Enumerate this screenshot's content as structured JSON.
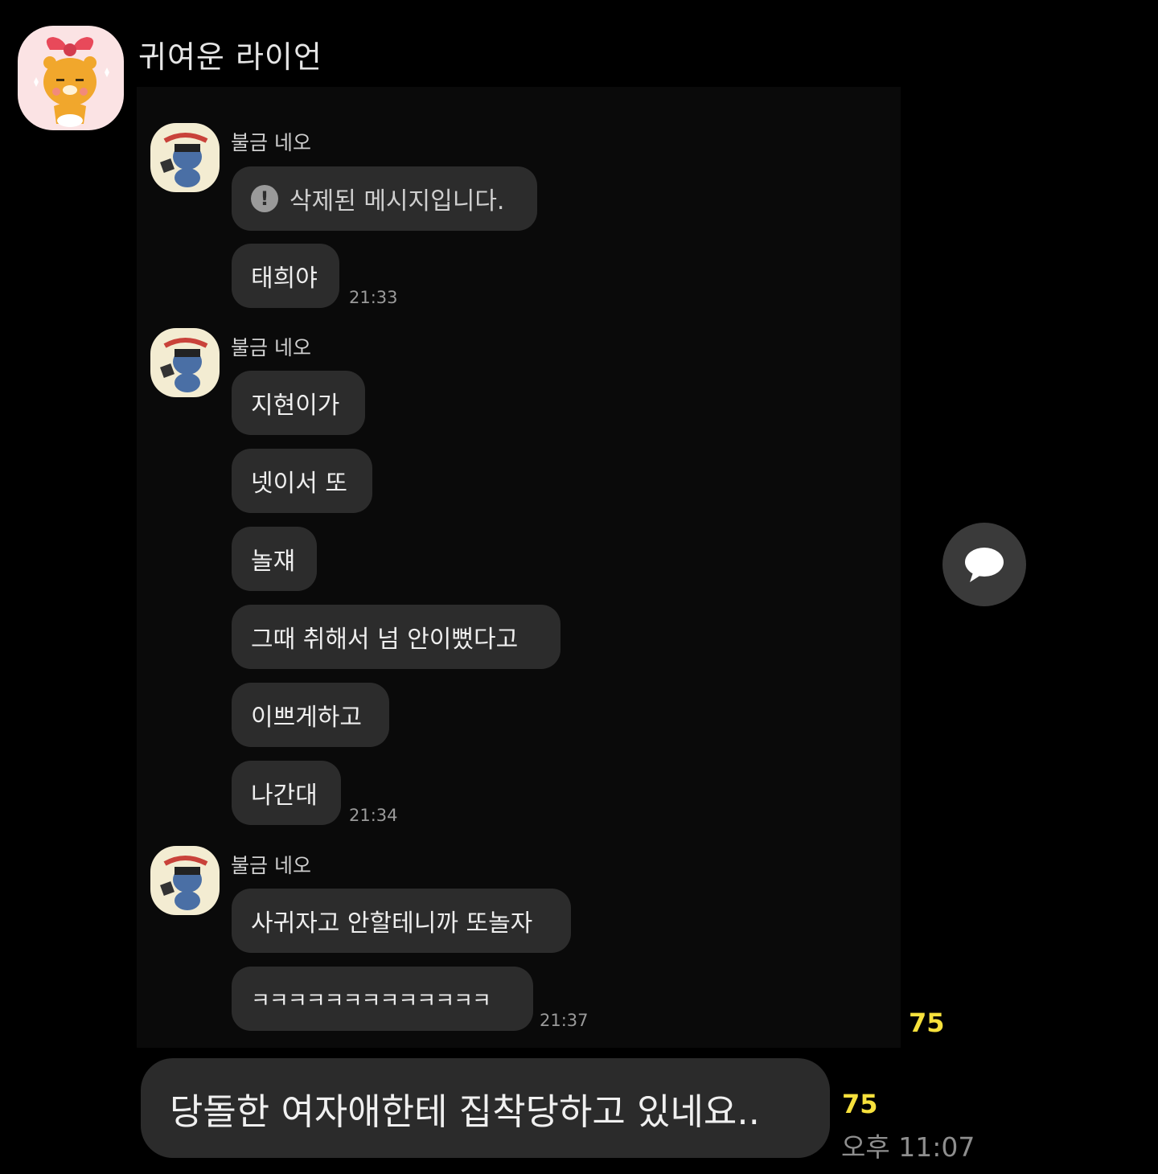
{
  "chat": {
    "title": "귀여운 라이언"
  },
  "embedded": {
    "groups": [
      {
        "sender": "불금 네오",
        "deleted_text": "삭제된 메시지입니다.",
        "messages": [
          "태희야"
        ],
        "time": "21:33"
      },
      {
        "sender": "불금 네오",
        "messages": [
          "지현이가",
          "넷이서 또",
          "놀쟤",
          "그때 취해서 넘 안이뻤다고",
          "이쁘게하고",
          "나간대"
        ],
        "time": "21:34"
      },
      {
        "sender": "불금 네오",
        "messages": [
          "사귀자고 안할테니까 또놀자",
          "ㅋㅋㅋㅋㅋㅋㅋㅋㅋㅋㅋㅋㅋ"
        ],
        "time": "21:37"
      }
    ],
    "unread_count": "75"
  },
  "my_message": {
    "text": "당돌한 여자애한테 집착당하고 있네요..",
    "unread_count": "75",
    "time": "오후 11:07"
  },
  "icons": {
    "chat_bubble": "speech-bubble-icon",
    "warning": "exclamation-icon"
  },
  "colors": {
    "background": "#000000",
    "bubble": "#2c2c2c",
    "unread": "#f7e13c"
  }
}
